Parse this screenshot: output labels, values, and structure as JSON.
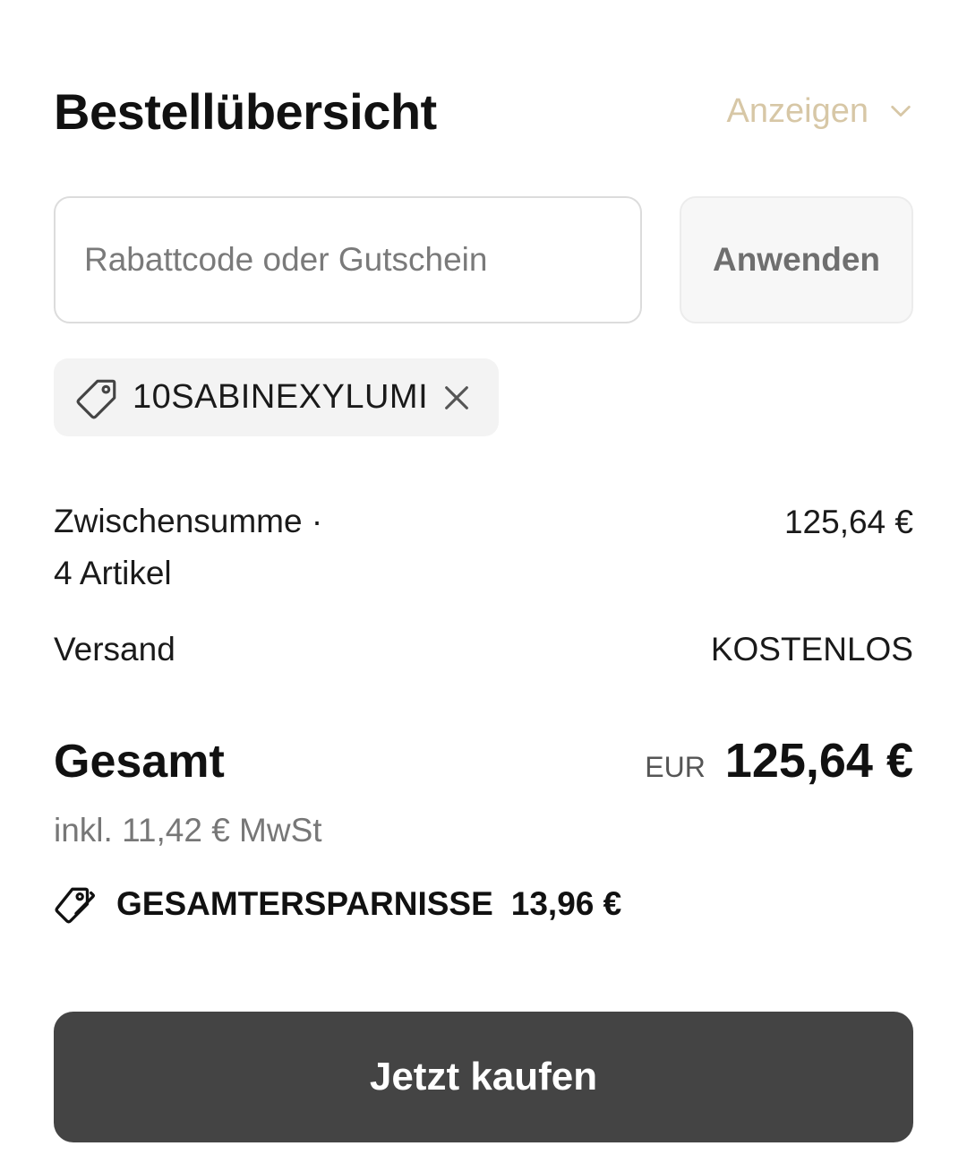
{
  "header": {
    "title": "Bestellübersicht",
    "toggle_label": "Anzeigen"
  },
  "discount": {
    "placeholder": "Rabattcode oder Gutschein",
    "value": "",
    "apply_label": "Anwenden",
    "applied_code": "10SABINEXYLUMI"
  },
  "summary": {
    "subtotal_label_line1": "Zwischensumme ·",
    "subtotal_label_line2": "4 Artikel",
    "subtotal_value": "125,64 €",
    "shipping_label": "Versand",
    "shipping_value": "KOSTENLOS",
    "total_label": "Gesamt",
    "total_currency": "EUR",
    "total_value": "125,64 €",
    "vat_text": "inkl. 11,42 € MwSt",
    "savings_label": "GESAMTERSPARNISSE",
    "savings_value": "13,96 €"
  },
  "checkout": {
    "buy_label": "Jetzt kaufen"
  },
  "colors": {
    "accent": "#d7c7a6",
    "button_bg": "#444444",
    "chip_bg": "#f3f3f3"
  },
  "icons": [
    "chevron-down-icon",
    "tag-icon",
    "close-icon",
    "tags-icon"
  ]
}
